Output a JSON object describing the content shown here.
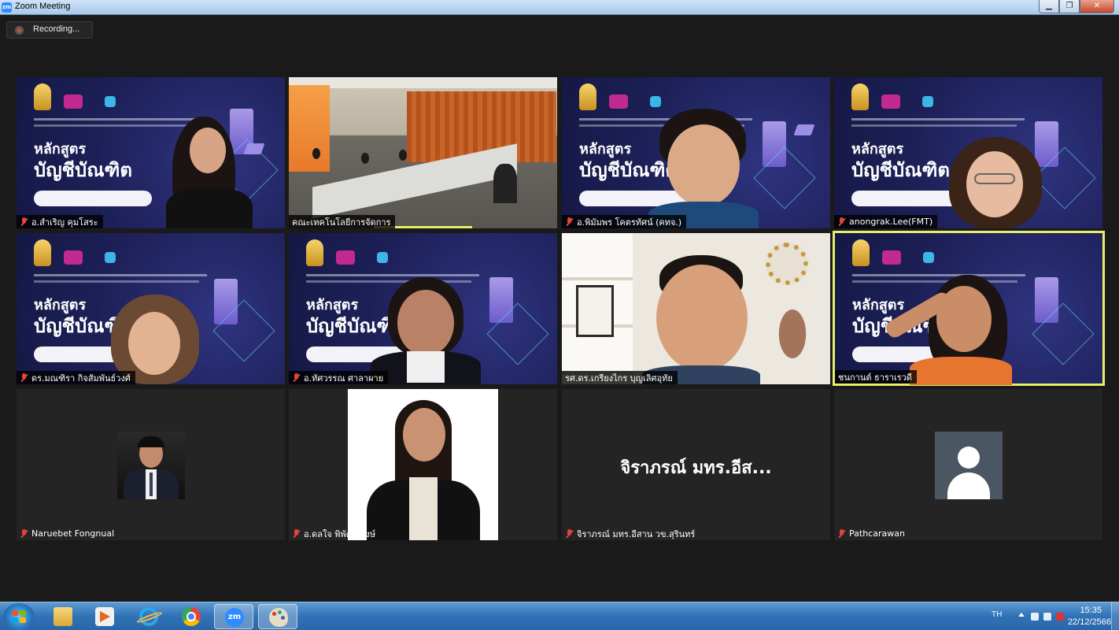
{
  "window": {
    "title": "Zoom Meeting",
    "app_icon": "zm",
    "min_label": "▁",
    "max_label": "❐",
    "close_label": "✕"
  },
  "recording": {
    "label": "Recording..."
  },
  "slide": {
    "line1": "หลักสูตร",
    "line2": "บัญชีบัณฑิต"
  },
  "participants": [
    {
      "name": "อ.สำเริญ คุมโสระ",
      "muted": true
    },
    {
      "name": "คณะเทคโนโลยีการจัดการ",
      "muted": false
    },
    {
      "name": "อ.พิมัมพร โคตรทัศน์ (คทจ.)",
      "muted": true
    },
    {
      "name": "anongrak.Lee(FMT)",
      "muted": true
    },
    {
      "name": "ดร.มณฑิรา กิจสัมพันธ์วงศ์",
      "muted": true
    },
    {
      "name": "อ.ทัศวรรณ ศาลาผาย",
      "muted": true
    },
    {
      "name": "รศ.ดร.เกรียงไกร บุญเลิศอุทัย",
      "muted": false
    },
    {
      "name": "ชนกานต์ ธาราเรวดี",
      "muted": false,
      "active_speaker": true
    },
    {
      "name": "Naruebet Fongnual",
      "muted": true
    },
    {
      "name": "อ.ดลใจ พิพัฒน์พงษ์",
      "muted": true
    },
    {
      "name": "จิราภรณ์ มทร.อีสาน วข.สุรินทร์",
      "muted": true,
      "center_label": "จิราภรณ์ มทร.อีส..."
    },
    {
      "name": "Pathcarawan",
      "muted": true
    }
  ],
  "taskbar": {
    "pinned": [
      "windows-explorer",
      "media-player",
      "internet-explorer",
      "chrome",
      "zoom",
      "paint"
    ],
    "zoom_label": "zm",
    "tray": {
      "language": "TH",
      "time": "15:35",
      "date": "22/12/2566"
    }
  },
  "colors": {
    "accent": "#2d8cff",
    "active_speaker_border": "#e6ee6a",
    "muted_icon": "#e0453c",
    "background": "#1a1a1a"
  }
}
